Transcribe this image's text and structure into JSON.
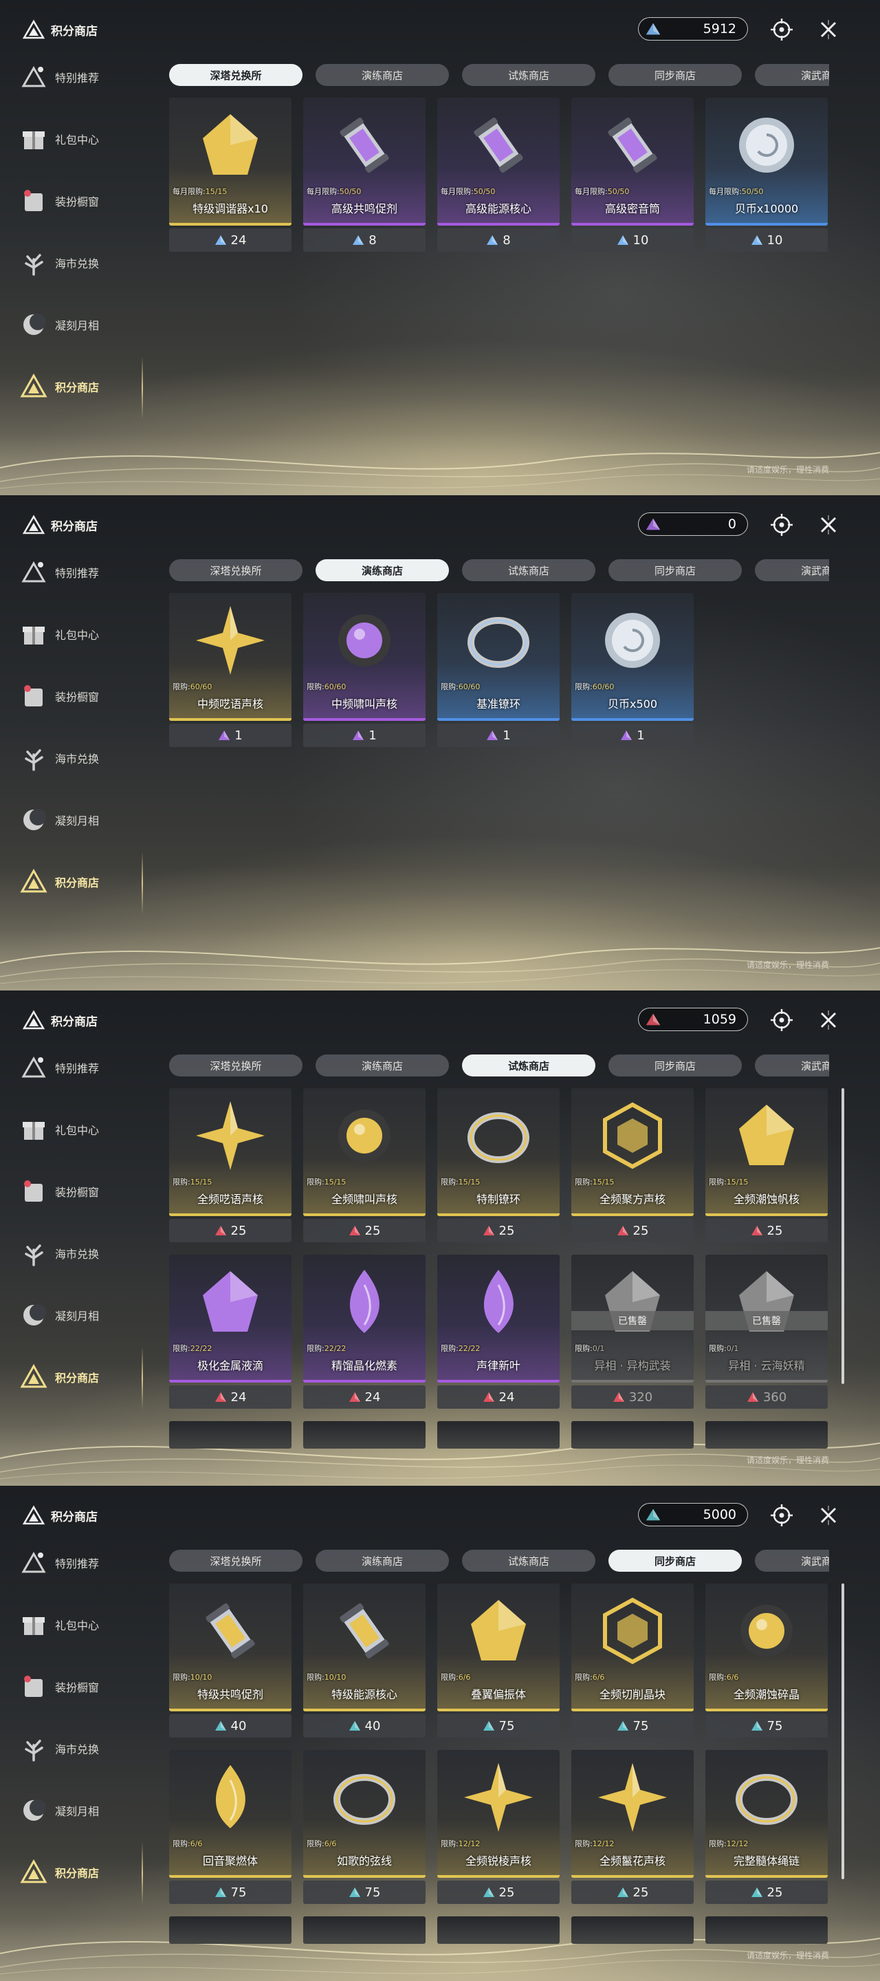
{
  "colors": {
    "gold": "#e0c452",
    "purple": "#a65ae0",
    "blue": "#4f90e6",
    "tab_active_bg": "#eef1f2",
    "active_nav": "#f6e7a6"
  },
  "brand_title": "积分商店",
  "footnote": "请适度娱乐，理性消费",
  "sidebar": [
    {
      "label": "特别推荐",
      "icon": "sparkle-book-icon"
    },
    {
      "label": "礼包中心",
      "icon": "gift-icon"
    },
    {
      "label": "装扮橱窗",
      "icon": "wardrobe-icon"
    },
    {
      "label": "海市兑换",
      "icon": "coral-icon"
    },
    {
      "label": "凝刻月相",
      "icon": "moon-icon"
    },
    {
      "label": "积分商店",
      "icon": "triangle-emblem-icon",
      "active": true
    }
  ],
  "tabs": [
    "深塔兑换所",
    "演练商店",
    "试炼商店",
    "同步商店",
    "演武商店"
  ],
  "panels": [
    {
      "currency": {
        "value": "5912",
        "color": "#7db6f0"
      },
      "active_tab": 0,
      "show_scrollbar": false,
      "stubs": false,
      "items": [
        {
          "limit_label": "每月限购:",
          "limit": "15/15",
          "name": "特级调谐器x10",
          "price": "24",
          "rarity": "gold",
          "icon": "tuner-crystal-icon"
        },
        {
          "limit_label": "每月限购:",
          "limit": "50/50",
          "name": "高级共鸣促剂",
          "price": "8",
          "rarity": "purple",
          "icon": "vial-icon"
        },
        {
          "limit_label": "每月限购:",
          "limit": "50/50",
          "name": "高级能源核心",
          "price": "8",
          "rarity": "purple",
          "icon": "energy-cell-icon"
        },
        {
          "limit_label": "每月限购:",
          "limit": "50/50",
          "name": "高级密音筒",
          "price": "10",
          "rarity": "purple",
          "icon": "sound-tube-icon"
        },
        {
          "limit_label": "每月限购:",
          "limit": "50/50",
          "name": "贝币x10000",
          "price": "10",
          "rarity": "blue",
          "icon": "shell-coin-icon"
        }
      ]
    },
    {
      "currency": {
        "value": "0",
        "color": "#a66ce0"
      },
      "active_tab": 1,
      "show_scrollbar": false,
      "stubs": false,
      "items": [
        {
          "limit_label": "限购:",
          "limit": "60/60",
          "name": "中频呓语声核",
          "price": "1",
          "rarity": "gold",
          "icon": "star-core-icon"
        },
        {
          "limit_label": "限购:",
          "limit": "60/60",
          "name": "中频啸叫声核",
          "price": "1",
          "rarity": "purple",
          "icon": "orb-core-icon"
        },
        {
          "limit_label": "限购:",
          "limit": "60/60",
          "name": "基准镣环",
          "price": "1",
          "rarity": "blue",
          "icon": "ring-icon"
        },
        {
          "limit_label": "限购:",
          "limit": "60/60",
          "name": "贝币x500",
          "price": "1",
          "rarity": "blue",
          "icon": "shell-coin-icon"
        }
      ]
    },
    {
      "currency": {
        "value": "1059",
        "color": "#e0505e"
      },
      "active_tab": 2,
      "show_scrollbar": true,
      "stubs": true,
      "items": [
        {
          "limit_label": "限购:",
          "limit": "15/15",
          "name": "全频呓语声核",
          "price": "25",
          "rarity": "gold",
          "icon": "star-core-icon"
        },
        {
          "limit_label": "限购:",
          "limit": "15/15",
          "name": "全频啸叫声核",
          "price": "25",
          "rarity": "gold",
          "icon": "orb-core-icon"
        },
        {
          "limit_label": "限购:",
          "limit": "15/15",
          "name": "特制镣环",
          "price": "25",
          "rarity": "gold",
          "icon": "ring-icon"
        },
        {
          "limit_label": "限购:",
          "limit": "15/15",
          "name": "全频聚方声核",
          "price": "25",
          "rarity": "gold",
          "icon": "hex-core-icon"
        },
        {
          "limit_label": "限购:",
          "limit": "15/15",
          "name": "全频潮蚀帆核",
          "price": "25",
          "rarity": "gold",
          "icon": "sail-core-icon"
        },
        {
          "limit_label": "限购:",
          "limit": "22/22",
          "name": "极化金属液滴",
          "price": "24",
          "rarity": "purple",
          "icon": "metal-drop-icon"
        },
        {
          "limit_label": "限购:",
          "limit": "22/22",
          "name": "精馏晶化燃素",
          "price": "24",
          "rarity": "purple",
          "icon": "flame-crystal-icon"
        },
        {
          "limit_label": "限购:",
          "limit": "22/22",
          "name": "声律新叶",
          "price": "24",
          "rarity": "purple",
          "icon": "leaf-flame-icon"
        },
        {
          "limit_label": "限购:",
          "limit": "0/1",
          "name": "异相 · 异构武装",
          "price": "320",
          "rarity": "gray",
          "icon": "armor-icon",
          "sold": "已售罄"
        },
        {
          "limit_label": "限购:",
          "limit": "0/1",
          "name": "异相 · 云海妖精",
          "price": "360",
          "rarity": "gray",
          "icon": "fairy-icon",
          "sold": "已售罄"
        }
      ]
    },
    {
      "currency": {
        "value": "5000",
        "color": "#5fc0c8"
      },
      "active_tab": 3,
      "show_scrollbar": true,
      "stubs": true,
      "items": [
        {
          "limit_label": "限购:",
          "limit": "10/10",
          "name": "特级共鸣促剂",
          "price": "40",
          "rarity": "gold",
          "icon": "vial-icon"
        },
        {
          "limit_label": "限购:",
          "limit": "10/10",
          "name": "特级能源核心",
          "price": "40",
          "rarity": "gold",
          "icon": "energy-cell-icon"
        },
        {
          "limit_label": "限购:",
          "limit": "6/6",
          "name": "叠翼偏振体",
          "price": "75",
          "rarity": "gold",
          "icon": "butterfly-icon"
        },
        {
          "limit_label": "限购:",
          "limit": "6/6",
          "name": "全频切削晶块",
          "price": "75",
          "rarity": "gold",
          "icon": "crystal-block-icon"
        },
        {
          "limit_label": "限购:",
          "limit": "6/6",
          "name": "全频潮蚀碎晶",
          "price": "75",
          "rarity": "gold",
          "icon": "shard-icon"
        },
        {
          "limit_label": "限购:",
          "limit": "6/6",
          "name": "回音聚燃体",
          "price": "75",
          "rarity": "gold",
          "icon": "feather-icon"
        },
        {
          "limit_label": "限购:",
          "limit": "6/6",
          "name": "如歌的弦线",
          "price": "75",
          "rarity": "gold",
          "icon": "string-icon"
        },
        {
          "limit_label": "限购:",
          "limit": "12/12",
          "name": "全频锐棱声核",
          "price": "25",
          "rarity": "gold",
          "icon": "prism-core-icon"
        },
        {
          "limit_label": "限购:",
          "limit": "12/12",
          "name": "全频鬣花声核",
          "price": "25",
          "rarity": "gold",
          "icon": "flower-core-icon"
        },
        {
          "limit_label": "限购:",
          "limit": "12/12",
          "name": "完整髓体绳链",
          "price": "25",
          "rarity": "gold",
          "icon": "chain-icon"
        }
      ]
    }
  ]
}
